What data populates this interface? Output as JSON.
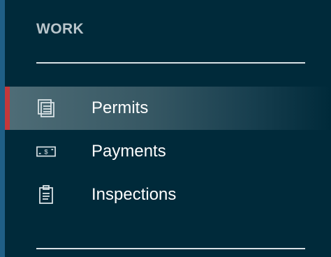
{
  "section": {
    "title": "WORK"
  },
  "nav": {
    "items": [
      {
        "label": "Permits",
        "icon": "permits-icon",
        "active": true
      },
      {
        "label": "Payments",
        "icon": "payments-icon",
        "active": false
      },
      {
        "label": "Inspections",
        "icon": "inspections-icon",
        "active": false
      }
    ]
  },
  "colors": {
    "background": "#002a3a",
    "active_indicator": "#c3383b",
    "text": "#ffffff",
    "section_title": "#b9c5cb",
    "left_edge": "#1f5f86"
  }
}
